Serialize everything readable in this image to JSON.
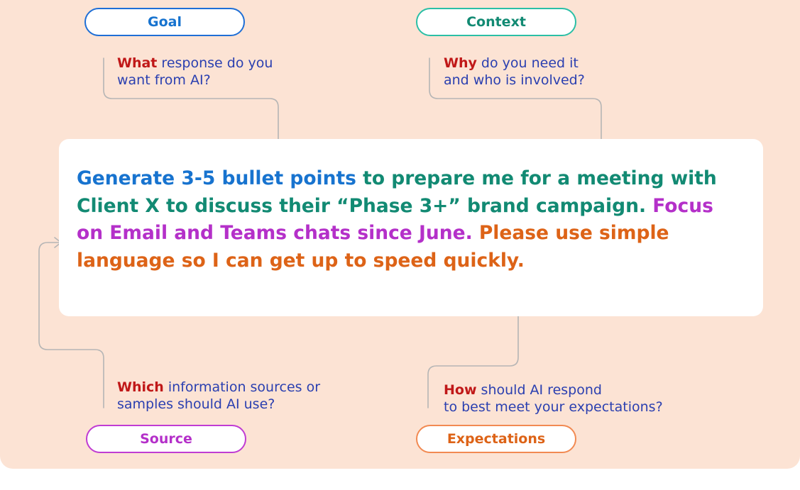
{
  "pills": {
    "goal": "Goal",
    "context": "Context",
    "source": "Source",
    "expectations": "Expectations"
  },
  "questions": {
    "goal": {
      "keyword": "What",
      "rest_line1": " response do you",
      "line2": "want from AI?"
    },
    "context": {
      "keyword": "Why",
      "rest_line1": " do you need it",
      "line2": "and who is involved?"
    },
    "source": {
      "keyword": "Which",
      "rest_line1": " information sources or",
      "line2": "samples should AI use?"
    },
    "expectations": {
      "keyword": "How",
      "rest_line1": " should AI respond",
      "line2": "to best meet your expectations?"
    }
  },
  "prompt": {
    "goal": "Generate 3-5 bullet points",
    "context": " to prepare me for a meeting with Client X to discuss their “Phase 3+” brand campaign.",
    "source": " Focus on Email and Teams chats since June.",
    "expectations": " Please use simple language so I can get up to speed quickly."
  },
  "colors": {
    "background": "#fce3d4",
    "goal": "#1773cf",
    "context": "#128a73",
    "source": "#b430c9",
    "expectations": "#dd6317",
    "keyword": "#c01818",
    "question_text": "#2a3fb0",
    "connector": "#b5b5b5"
  }
}
